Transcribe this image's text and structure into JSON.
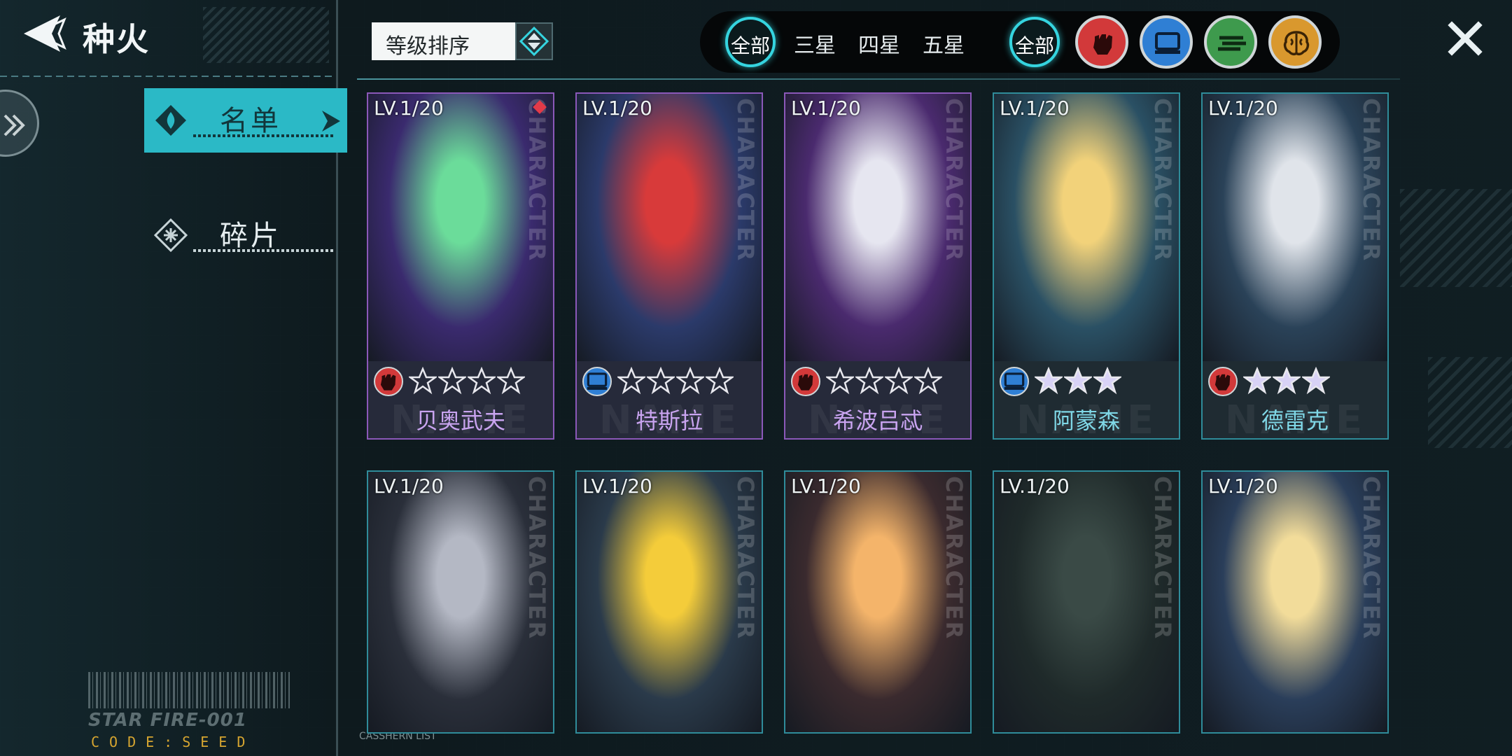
{
  "header": {
    "title": "种火"
  },
  "sidebar": {
    "tabs": [
      {
        "label": "名单",
        "active": true
      },
      {
        "label": "碎片",
        "active": false
      }
    ],
    "footer": {
      "line1": "STAR FIRE-001",
      "line2": "CODE:SEED"
    },
    "list_label": "CASSHERN LIST"
  },
  "sort": {
    "label": "等级排序"
  },
  "filters": {
    "rarity": [
      "全部",
      "三星",
      "四星",
      "五星"
    ],
    "class_all": "全部",
    "classes": [
      {
        "icon": "fist-icon",
        "color": "#d2393a"
      },
      {
        "icon": "monitor-icon",
        "color": "#2f7fd4"
      },
      {
        "icon": "speed-icon",
        "color": "#3e9a4d"
      },
      {
        "icon": "brain-icon",
        "color": "#d9982e"
      }
    ]
  },
  "cards": [
    {
      "level": "LV.1/20",
      "name": "贝奥武夫",
      "stars": 4,
      "star_style": "outline",
      "class": "fist",
      "frame": "purple",
      "side_text": "CHARACTER",
      "bg_text": "NAME"
    },
    {
      "level": "LV.1/20",
      "name": "特斯拉",
      "stars": 4,
      "star_style": "outline",
      "class": "monitor",
      "frame": "purple",
      "side_text": "CHARACTER",
      "bg_text": "NAME"
    },
    {
      "level": "LV.1/20",
      "name": "希波吕忒",
      "stars": 4,
      "star_style": "outline",
      "class": "fist",
      "frame": "purple",
      "side_text": "CHARACTER",
      "bg_text": "NAME"
    },
    {
      "level": "LV.1/20",
      "name": "阿蒙森",
      "stars": 3,
      "star_style": "solid",
      "class": "monitor",
      "frame": "teal",
      "side_text": "CHARACTER",
      "bg_text": "NAME"
    },
    {
      "level": "LV.1/20",
      "name": "德雷克",
      "stars": 3,
      "star_style": "solid",
      "class": "fist",
      "frame": "teal",
      "side_text": "CHARACTER",
      "bg_text": "NAME"
    },
    {
      "level": "LV.1/20",
      "name": "",
      "frame": "teal",
      "side_text": "CHARACTER"
    },
    {
      "level": "LV.1/20",
      "name": "",
      "frame": "teal",
      "side_text": "CHARACTER"
    },
    {
      "level": "LV.1/20",
      "name": "",
      "frame": "teal",
      "side_text": "CHARACTER"
    },
    {
      "level": "LV.1/20",
      "name": "",
      "frame": "teal",
      "side_text": "CHARACTER"
    },
    {
      "level": "LV.1/20",
      "name": "",
      "frame": "teal",
      "side_text": "CHARACTER"
    }
  ]
}
